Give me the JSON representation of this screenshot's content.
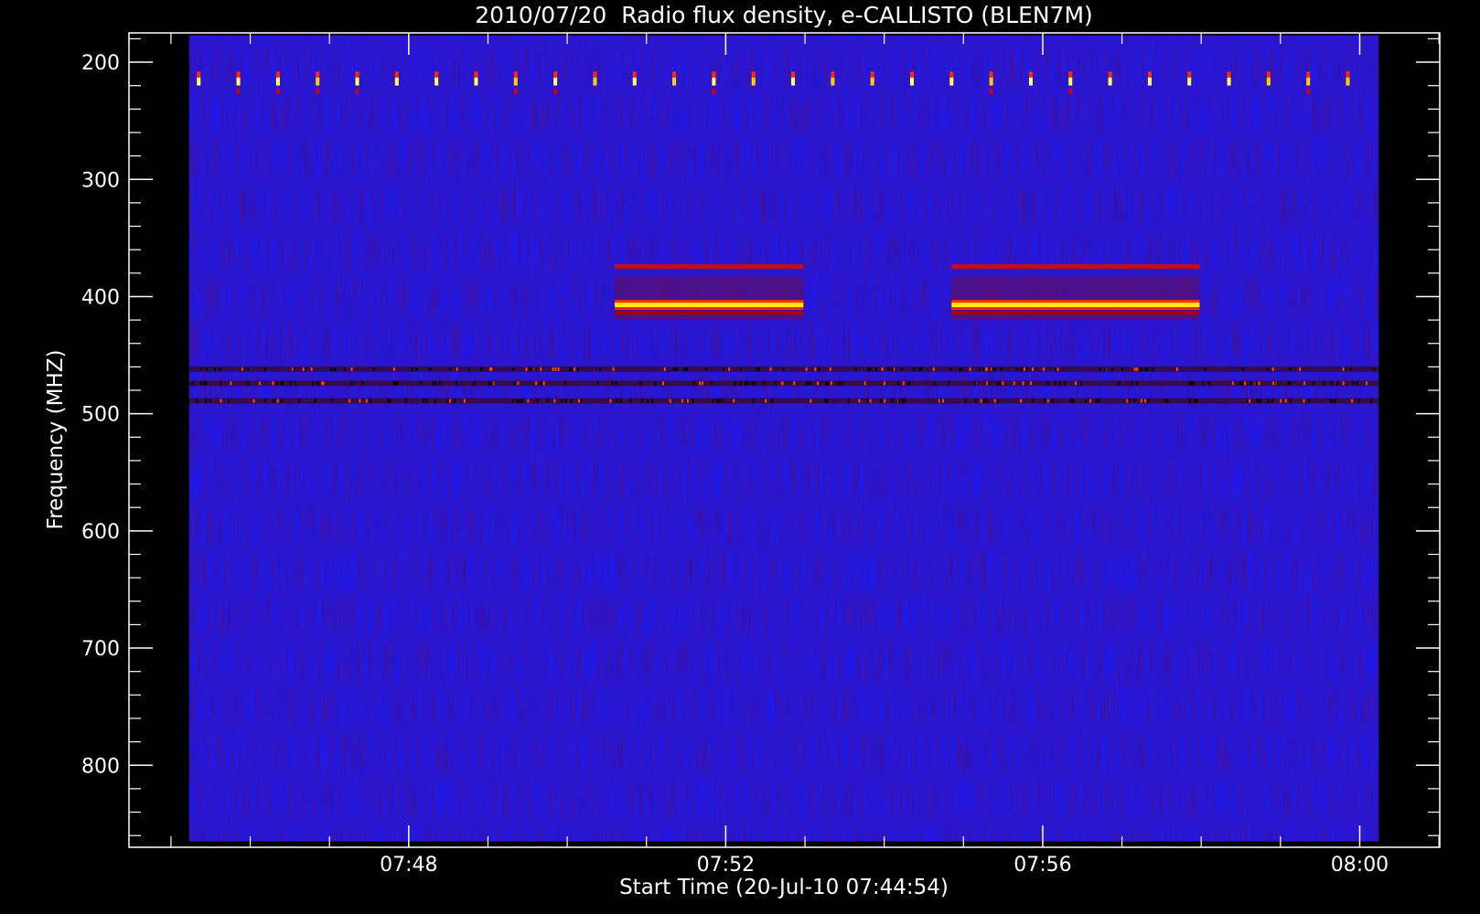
{
  "chart_data": {
    "type": "heatmap",
    "title": "2010/07/20  Radio flux density, e-CALLISTO (BLEN7M)",
    "xlabel": "Start Time (20-Jul-10 07:44:54)",
    "ylabel": "Frequency (MHZ)",
    "x_ticks": [
      {
        "label": "07:48",
        "minutes": 468
      },
      {
        "label": "07:52",
        "minutes": 472
      },
      {
        "label": "07:56",
        "minutes": 476
      },
      {
        "label": "08:00",
        "minutes": 480
      }
    ],
    "y_ticks": [
      200,
      300,
      400,
      500,
      600,
      700,
      800
    ],
    "xlim_minutes": [
      464.47,
      481.01
    ],
    "ylim_mhz": [
      870,
      175
    ],
    "data_xlim_minutes": [
      465.23,
      480.24
    ],
    "data_ylim_mhz": [
      865,
      177
    ],
    "colorscale": [
      "#0000ff",
      "#8b0000",
      "#ff0000",
      "#ffff00",
      "#00ff00"
    ],
    "background_color": "#1a1af0",
    "features": [
      {
        "type": "periodic_bursts",
        "freq_mhz": [
          208,
          225
        ],
        "t_start": 465.35,
        "t_end": 480.2,
        "period_min": 0.5
      },
      {
        "type": "band",
        "name": "strong_band_1",
        "t_start": 470.6,
        "t_end": 472.98,
        "freq_mhz": 406,
        "intensity": "high"
      },
      {
        "type": "band",
        "name": "strong_band_2",
        "t_start": 474.85,
        "t_end": 477.98,
        "freq_mhz": 406,
        "intensity": "high"
      },
      {
        "type": "band",
        "name": "weak_band_1",
        "t_start": 470.6,
        "t_end": 472.98,
        "freq_mhz": 374,
        "intensity": "low"
      },
      {
        "type": "band",
        "name": "weak_band_2",
        "t_start": 474.85,
        "t_end": 477.98,
        "freq_mhz": 374,
        "intensity": "low"
      },
      {
        "type": "interference_line",
        "freq_mhz": 462,
        "t_start": 465.23,
        "t_end": 480.24
      },
      {
        "type": "interference_line",
        "freq_mhz": 489,
        "t_start": 465.23,
        "t_end": 480.24
      },
      {
        "type": "interference_line",
        "freq_mhz": 474,
        "t_start": 465.23,
        "t_end": 480.24
      }
    ]
  }
}
